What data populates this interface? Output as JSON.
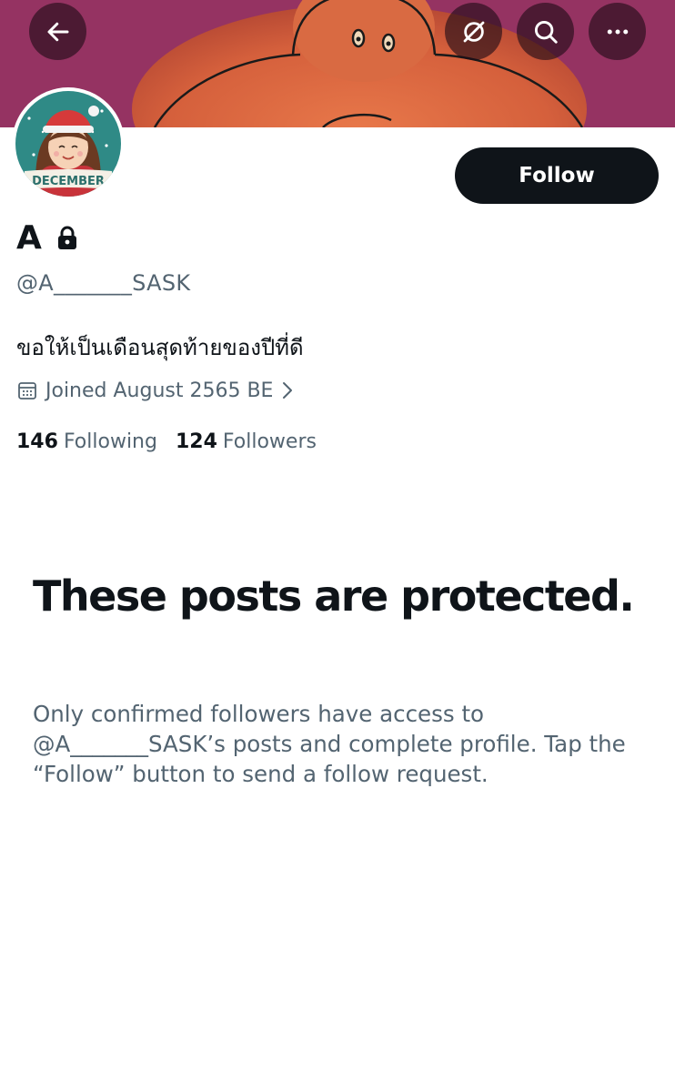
{
  "header": {
    "back_icon": "arrow-left-icon",
    "subscribe_icon": "slashed-circle-icon",
    "search_icon": "search-icon",
    "more_icon": "more-horizontal-icon",
    "banner_color": "#8a2a5c"
  },
  "profile": {
    "avatar_badge_text": "DECEMBER",
    "display_name": "A",
    "locked_icon": "lock-icon",
    "handle": "@A_______SASK",
    "bio": "ขอให้เป็นเดือนสุดท้ายของปีที่ดี",
    "joined": "Joined August 2565 BE",
    "following_count": "146",
    "following_label": "Following",
    "followers_count": "124",
    "followers_label": "Followers"
  },
  "actions": {
    "follow_label": "Follow"
  },
  "protected": {
    "title": "These posts are protected.",
    "description": "Only confirmed followers have access to @A_______SASK’s posts and complete profile. Tap the “Follow” button to send a follow request."
  },
  "colors": {
    "primary_text": "#0f1419",
    "secondary_text": "#536471",
    "button_bg": "#0f1419"
  }
}
